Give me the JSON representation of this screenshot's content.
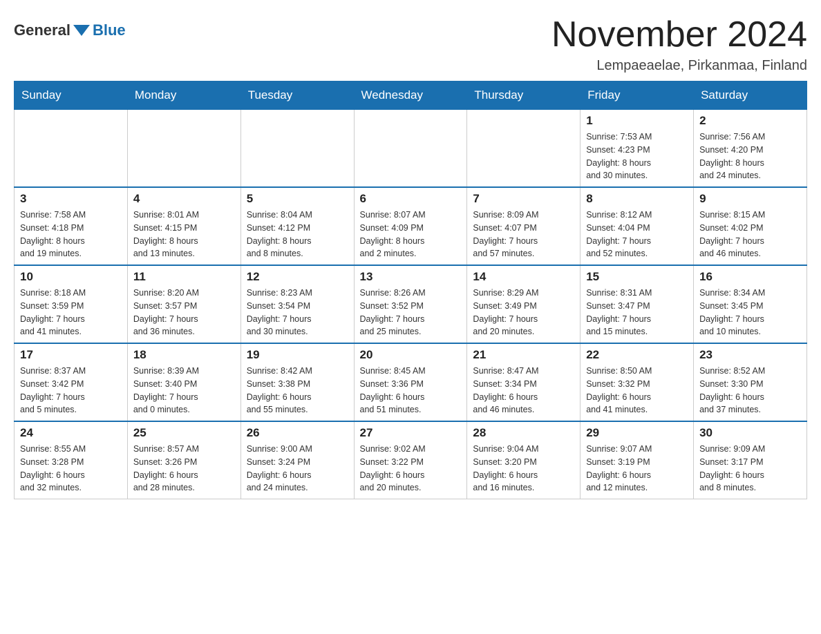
{
  "header": {
    "logo_general": "General",
    "logo_blue": "Blue",
    "month_title": "November 2024",
    "location": "Lempaeaelae, Pirkanmaa, Finland"
  },
  "weekdays": [
    "Sunday",
    "Monday",
    "Tuesday",
    "Wednesday",
    "Thursday",
    "Friday",
    "Saturday"
  ],
  "weeks": [
    [
      {
        "day": "",
        "info": ""
      },
      {
        "day": "",
        "info": ""
      },
      {
        "day": "",
        "info": ""
      },
      {
        "day": "",
        "info": ""
      },
      {
        "day": "",
        "info": ""
      },
      {
        "day": "1",
        "info": "Sunrise: 7:53 AM\nSunset: 4:23 PM\nDaylight: 8 hours\nand 30 minutes."
      },
      {
        "day": "2",
        "info": "Sunrise: 7:56 AM\nSunset: 4:20 PM\nDaylight: 8 hours\nand 24 minutes."
      }
    ],
    [
      {
        "day": "3",
        "info": "Sunrise: 7:58 AM\nSunset: 4:18 PM\nDaylight: 8 hours\nand 19 minutes."
      },
      {
        "day": "4",
        "info": "Sunrise: 8:01 AM\nSunset: 4:15 PM\nDaylight: 8 hours\nand 13 minutes."
      },
      {
        "day": "5",
        "info": "Sunrise: 8:04 AM\nSunset: 4:12 PM\nDaylight: 8 hours\nand 8 minutes."
      },
      {
        "day": "6",
        "info": "Sunrise: 8:07 AM\nSunset: 4:09 PM\nDaylight: 8 hours\nand 2 minutes."
      },
      {
        "day": "7",
        "info": "Sunrise: 8:09 AM\nSunset: 4:07 PM\nDaylight: 7 hours\nand 57 minutes."
      },
      {
        "day": "8",
        "info": "Sunrise: 8:12 AM\nSunset: 4:04 PM\nDaylight: 7 hours\nand 52 minutes."
      },
      {
        "day": "9",
        "info": "Sunrise: 8:15 AM\nSunset: 4:02 PM\nDaylight: 7 hours\nand 46 minutes."
      }
    ],
    [
      {
        "day": "10",
        "info": "Sunrise: 8:18 AM\nSunset: 3:59 PM\nDaylight: 7 hours\nand 41 minutes."
      },
      {
        "day": "11",
        "info": "Sunrise: 8:20 AM\nSunset: 3:57 PM\nDaylight: 7 hours\nand 36 minutes."
      },
      {
        "day": "12",
        "info": "Sunrise: 8:23 AM\nSunset: 3:54 PM\nDaylight: 7 hours\nand 30 minutes."
      },
      {
        "day": "13",
        "info": "Sunrise: 8:26 AM\nSunset: 3:52 PM\nDaylight: 7 hours\nand 25 minutes."
      },
      {
        "day": "14",
        "info": "Sunrise: 8:29 AM\nSunset: 3:49 PM\nDaylight: 7 hours\nand 20 minutes."
      },
      {
        "day": "15",
        "info": "Sunrise: 8:31 AM\nSunset: 3:47 PM\nDaylight: 7 hours\nand 15 minutes."
      },
      {
        "day": "16",
        "info": "Sunrise: 8:34 AM\nSunset: 3:45 PM\nDaylight: 7 hours\nand 10 minutes."
      }
    ],
    [
      {
        "day": "17",
        "info": "Sunrise: 8:37 AM\nSunset: 3:42 PM\nDaylight: 7 hours\nand 5 minutes."
      },
      {
        "day": "18",
        "info": "Sunrise: 8:39 AM\nSunset: 3:40 PM\nDaylight: 7 hours\nand 0 minutes."
      },
      {
        "day": "19",
        "info": "Sunrise: 8:42 AM\nSunset: 3:38 PM\nDaylight: 6 hours\nand 55 minutes."
      },
      {
        "day": "20",
        "info": "Sunrise: 8:45 AM\nSunset: 3:36 PM\nDaylight: 6 hours\nand 51 minutes."
      },
      {
        "day": "21",
        "info": "Sunrise: 8:47 AM\nSunset: 3:34 PM\nDaylight: 6 hours\nand 46 minutes."
      },
      {
        "day": "22",
        "info": "Sunrise: 8:50 AM\nSunset: 3:32 PM\nDaylight: 6 hours\nand 41 minutes."
      },
      {
        "day": "23",
        "info": "Sunrise: 8:52 AM\nSunset: 3:30 PM\nDaylight: 6 hours\nand 37 minutes."
      }
    ],
    [
      {
        "day": "24",
        "info": "Sunrise: 8:55 AM\nSunset: 3:28 PM\nDaylight: 6 hours\nand 32 minutes."
      },
      {
        "day": "25",
        "info": "Sunrise: 8:57 AM\nSunset: 3:26 PM\nDaylight: 6 hours\nand 28 minutes."
      },
      {
        "day": "26",
        "info": "Sunrise: 9:00 AM\nSunset: 3:24 PM\nDaylight: 6 hours\nand 24 minutes."
      },
      {
        "day": "27",
        "info": "Sunrise: 9:02 AM\nSunset: 3:22 PM\nDaylight: 6 hours\nand 20 minutes."
      },
      {
        "day": "28",
        "info": "Sunrise: 9:04 AM\nSunset: 3:20 PM\nDaylight: 6 hours\nand 16 minutes."
      },
      {
        "day": "29",
        "info": "Sunrise: 9:07 AM\nSunset: 3:19 PM\nDaylight: 6 hours\nand 12 minutes."
      },
      {
        "day": "30",
        "info": "Sunrise: 9:09 AM\nSunset: 3:17 PM\nDaylight: 6 hours\nand 8 minutes."
      }
    ]
  ]
}
